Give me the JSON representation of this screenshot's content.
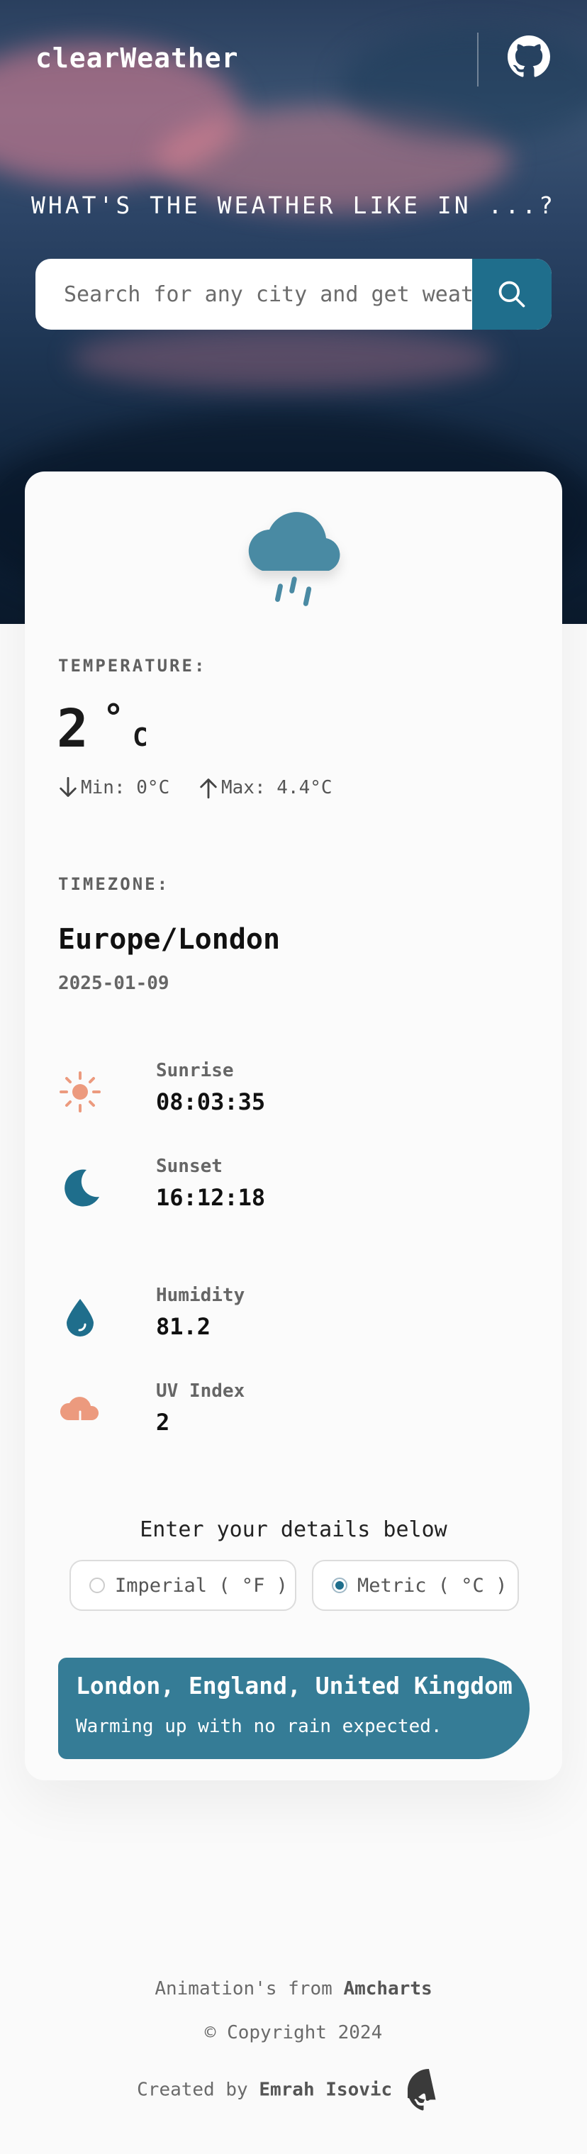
{
  "header": {
    "brand": "clearWeather",
    "github_icon": "github-icon"
  },
  "hero": {
    "title": "WHAT'S THE WEATHER LIKE IN ...?"
  },
  "search": {
    "placeholder": "Search for any city and get weather",
    "button_icon": "search-icon"
  },
  "weather": {
    "animation_icon": "rainy-cloud-icon",
    "temperature_label": "TEMPERATURE:",
    "temperature_value": "2",
    "temperature_degree": "°",
    "temperature_unit": "C",
    "min": "Min: 0°C",
    "max": "Max: 4.4°C",
    "timezone_label": "TIMEZONE:",
    "timezone": "Europe/London",
    "date": "2025-01-09",
    "sunrise_label": "Sunrise",
    "sunrise": "08:03:35",
    "sunset_label": "Sunset",
    "sunset": "16:12:18",
    "humidity_label": "Humidity",
    "humidity": "81.2",
    "uv_label": "UV Index",
    "uv": "2"
  },
  "units": {
    "title": "Enter your details below",
    "imperial": "Imperial ( °F )",
    "metric": "Metric ( °C )",
    "selected": "metric"
  },
  "location": {
    "name": "London, England, United Kingdom",
    "summary": "Warming up with no rain expected."
  },
  "footer": {
    "animation_prefix": "Animation's from",
    "animation_source": "Amcharts",
    "copyright": "© Copyright 2024",
    "created_prefix": "Created by",
    "author": "Emrah Isovic"
  },
  "colors": {
    "accent": "#1f6e8c",
    "location_box": "#357c96",
    "sun": "#ec9a7e"
  }
}
